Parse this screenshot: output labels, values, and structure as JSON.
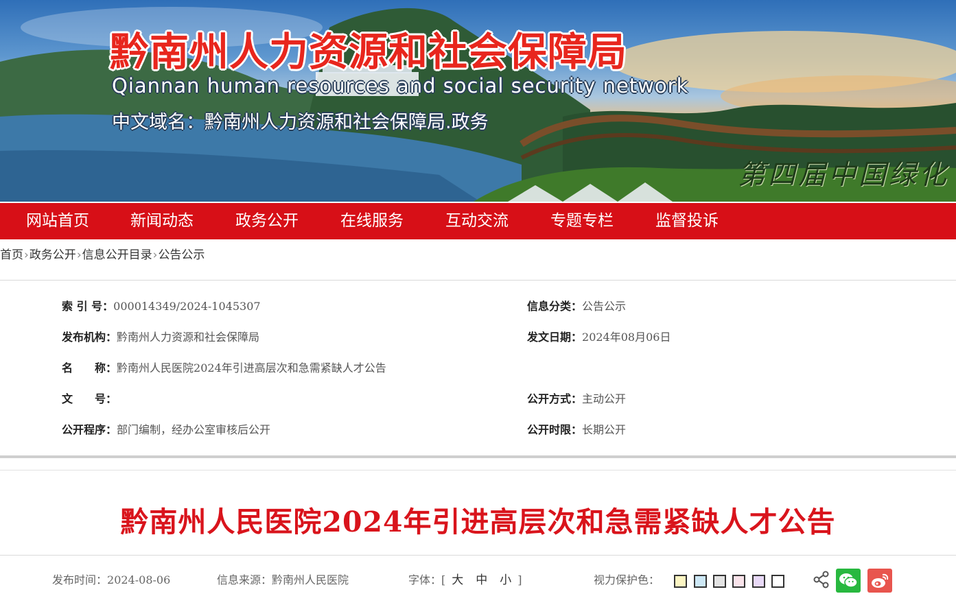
{
  "banner": {
    "title": "黔南州人力资源和社会保障局",
    "subtitle": "Qiannan human resources and social security network",
    "domain": "中文域名：黔南州人力资源和社会保障局.政务",
    "calligraphy": "第四届中国绿化"
  },
  "nav": {
    "items": [
      {
        "label": "网站首页"
      },
      {
        "label": "新闻动态"
      },
      {
        "label": "政务公开"
      },
      {
        "label": "在线服务"
      },
      {
        "label": "互动交流"
      },
      {
        "label": "专题专栏"
      },
      {
        "label": "监督投诉"
      }
    ],
    "color": "#d70f17"
  },
  "breadcrumb": {
    "items": [
      "首页",
      "政务公开",
      "信息公开目录",
      "公告公示"
    ],
    "separator": "›"
  },
  "meta": {
    "index_no": {
      "label": "索 引 号：",
      "value": "000014349/2024-1045307"
    },
    "category": {
      "label": "信息分类：",
      "value": "公告公示"
    },
    "publisher": {
      "label": "发布机构：",
      "value": "黔南州人力资源和社会保障局"
    },
    "issue_date": {
      "label": "发文日期：",
      "value": "2024年08月06日"
    },
    "name": {
      "label": "名　　称：",
      "value": "黔南州人民医院2024年引进高层次和急需紧缺人才公告"
    },
    "doc_no": {
      "label": "文　　号：",
      "value": ""
    },
    "disclosure_method": {
      "label": "公开方式：",
      "value": "主动公开"
    },
    "procedure": {
      "label": "公开程序：",
      "value": "部门编制，经办公室审核后公开"
    },
    "time_limit": {
      "label": "公开时限：",
      "value": "长期公开"
    }
  },
  "article": {
    "title": "黔南州人民医院2024年引进高层次和急需紧缺人才公告",
    "title_color": "#d9141c"
  },
  "info_bar": {
    "publish_time_label": "发布时间：",
    "publish_time": "2024-08-06",
    "source_label": "信息来源：",
    "source": "黔南州人民医院",
    "font_label": "字体：[",
    "font_large": "大",
    "font_medium": "中",
    "font_small": "小",
    "font_close": "]",
    "eye_care_label": "视力保护色：",
    "eye_care_colors": [
      "#fdf6c3",
      "#cde8f6",
      "#e3e3e3",
      "#f9e3ea",
      "#e8d9f7",
      "#ffffff"
    ],
    "share_icons": [
      "share-icon",
      "wechat-icon",
      "weibo-icon"
    ]
  }
}
